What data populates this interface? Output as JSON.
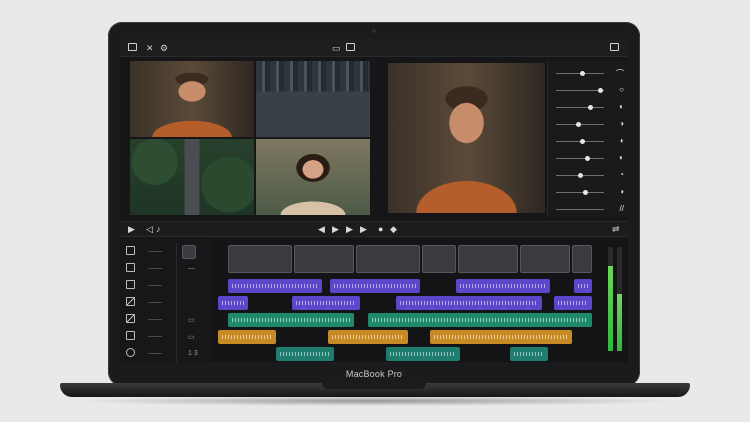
{
  "device": {
    "brand_label": "MacBook Pro"
  },
  "toolbar": {
    "icons": [
      "sidebar-icon",
      "close-icon",
      "settings-icon",
      "camera-icon",
      "display-icon",
      "window-icon"
    ]
  },
  "viewer": {
    "grid_scenes": [
      "man",
      "city",
      "forest",
      "woman"
    ],
    "main_scene": "man"
  },
  "inspector": {
    "rows": [
      {
        "glyph": "⌒",
        "level": 0.55
      },
      {
        "glyph": "○",
        "level": 0.92
      },
      {
        "glyph": "◐",
        "level": 0.7
      },
      {
        "glyph": "◑",
        "level": 0.45
      },
      {
        "glyph": "◖",
        "level": 0.55
      },
      {
        "glyph": "◐",
        "level": 0.65
      },
      {
        "glyph": "◔",
        "level": 0.5
      },
      {
        "glyph": "◑",
        "level": 0.6
      },
      {
        "glyph": "//",
        "level": 0.0
      }
    ]
  },
  "transport": {
    "buttons": [
      "play",
      "rewind",
      "volume",
      "skip-back",
      "play-main",
      "skip-forward",
      "record",
      "loop",
      "settings"
    ]
  },
  "timeline": {
    "meters": [
      0.82,
      0.55
    ],
    "meter_labels": [
      "-6",
      "-12",
      "-24",
      "INF"
    ],
    "mini_labels": [
      "",
      "",
      "",
      "",
      "",
      "",
      "1 3"
    ]
  },
  "colors": {
    "purple_clip": "#5a47c9",
    "green_clip": "#1f8a6a",
    "orange_clip": "#c78a25",
    "meter": "#2fb83e"
  }
}
